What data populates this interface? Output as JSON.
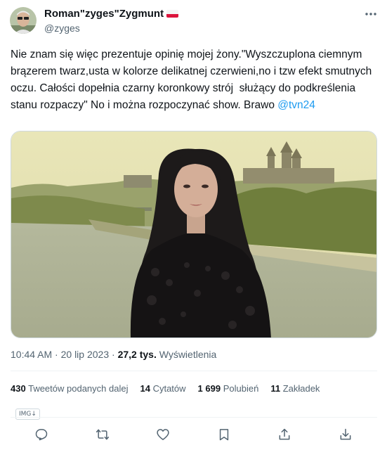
{
  "author": {
    "display_name": "Roman\"zyges\"Zygmunt",
    "handle": "@zyges",
    "flag": "PL",
    "more_icon": "more-horizontal-icon"
  },
  "tweet": {
    "text": "Nie znam się więc prezentuje opinię mojej żony.\"Wyszczuplona ciemnym brązerem twarz,usta w kolorze delikatnej czerwieni,no i tzw efekt smutnych oczu. Całości dopełnia czarny koronkowy strój  służący do podkreślenia stanu rozpaczy\" No i można rozpoczynać show. Brawo ",
    "mention": "@tvn24"
  },
  "meta": {
    "time": "10:44 AM",
    "separator": " · ",
    "date": "20 lip 2023",
    "views_count": "27,2 tys.",
    "views_label": "Wyświetlenia"
  },
  "stats": [
    {
      "count": "430",
      "label": "Tweetów podanych dalej"
    },
    {
      "count": "14",
      "label": "Cytatów"
    },
    {
      "count": "1 699",
      "label": "Polubień"
    },
    {
      "count": "11",
      "label": "Zakładek"
    }
  ],
  "badge": "IMG↓",
  "actions": [
    {
      "name": "reply-icon"
    },
    {
      "name": "retweet-icon"
    },
    {
      "name": "like-icon"
    },
    {
      "name": "bookmark-icon"
    },
    {
      "name": "share-icon"
    },
    {
      "name": "download-icon"
    }
  ],
  "colors": {
    "link": "#1d9bf0",
    "text": "#0f1419",
    "secondary": "#536471",
    "border": "#eff3f4"
  }
}
